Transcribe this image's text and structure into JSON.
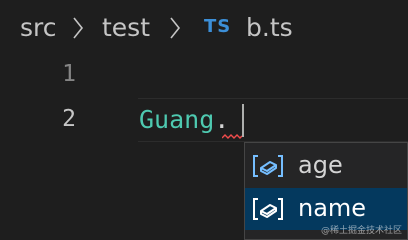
{
  "breadcrumb": {
    "folder1": "src",
    "folder2": "test",
    "file_icon": "TS",
    "file_name": "b.ts"
  },
  "editor": {
    "line_numbers": [
      "1",
      "2"
    ],
    "code_identifier": "Guang",
    "code_dot": "."
  },
  "suggest": {
    "items": [
      {
        "label": "age",
        "icon": "field-icon",
        "selected": false
      },
      {
        "label": "name",
        "icon": "field-icon",
        "selected": true
      }
    ]
  },
  "watermark": "@稀土掘金技术社区",
  "colors": {
    "background": "#1e1e1e",
    "identifier": "#4ec9b0",
    "ts_icon": "#3c8fd8",
    "field_icon": "#75beff",
    "selected_item": "#04395e",
    "error_squiggle": "#f14c4c"
  }
}
